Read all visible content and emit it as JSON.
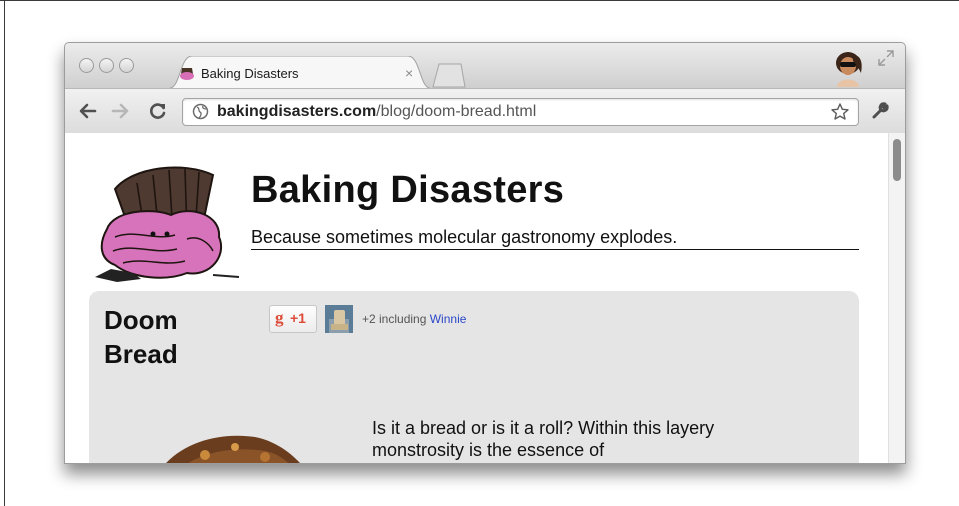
{
  "tab": {
    "title": "Baking Disasters",
    "close_glyph": "×"
  },
  "address": {
    "domain": "bakingdisasters.com",
    "path": "/blog/doom-bread.html"
  },
  "icons": {
    "back": "back-arrow-icon",
    "forward": "forward-arrow-icon",
    "reload": "reload-icon",
    "site": "globe-icon",
    "bookmark": "star-icon",
    "settings": "wrench-icon",
    "fullscreen": "fullscreen-icon"
  },
  "page": {
    "site_title": "Baking Disasters",
    "tagline": "Because sometimes molecular gastronomy explodes.",
    "post": {
      "title_line1": "Doom",
      "title_line2": "Bread",
      "plusone_label": "+1",
      "plus_prefix": "+2 including",
      "plus_link": "Winnie",
      "body": "Is it a bread or is it a roll? Within this layery monstrosity is the essence of"
    }
  },
  "colors": {
    "link": "#2b47c9",
    "plusone": "#dd4b39",
    "post_bg": "#e5e5e5"
  }
}
